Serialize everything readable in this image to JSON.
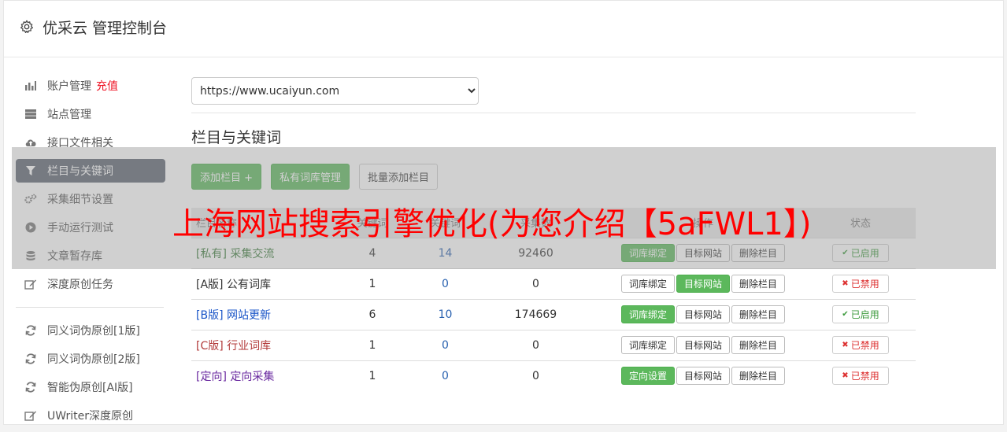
{
  "header": {
    "title": "优采云 管理控制台"
  },
  "sidebar": {
    "items": [
      {
        "label": "账户管理",
        "extra": "充值",
        "icon": "bar-chart-icon"
      },
      {
        "label": "站点管理",
        "icon": "server-icon"
      },
      {
        "label": "接口文件相关",
        "icon": "cloud-upload-icon"
      },
      {
        "label": "栏目与关键词",
        "icon": "filter-icon",
        "active": true
      },
      {
        "label": "采集细节设置",
        "icon": "cogs-icon"
      },
      {
        "label": "手动运行测试",
        "icon": "play-icon"
      },
      {
        "label": "文章暂存库",
        "icon": "database-icon"
      },
      {
        "label": "深度原创任务",
        "icon": "edit-icon"
      }
    ],
    "items2": [
      {
        "label": "同义词伪原创[1版]",
        "icon": "refresh-icon"
      },
      {
        "label": "同义词伪原创[2版]",
        "icon": "refresh-icon"
      },
      {
        "label": "智能伪原创[AI版]",
        "icon": "refresh-icon"
      },
      {
        "label": "UWriter深度原创",
        "icon": "edit-icon"
      }
    ]
  },
  "main": {
    "site_select": "https://www.ucaiyun.com",
    "section_title": "栏目与关键词",
    "buttons": {
      "add": "添加栏目 +",
      "private_lib": "私有词库管理",
      "batch_add": "批量添加栏目"
    },
    "table": {
      "headers": [
        "栏目名称",
        "关键词",
        "关键词",
        "采集数",
        "操作",
        "状态"
      ],
      "rows": [
        {
          "tag": "[私有]",
          "name": "采集交流",
          "c1": "4",
          "c2": "14",
          "c3": "92460",
          "ops": [
            "词库绑定",
            "目标网站",
            "删除栏目"
          ],
          "green": 0,
          "status": "已启用",
          "on": true,
          "cls": "tag-private"
        },
        {
          "tag": "[A版]",
          "name": "公有词库",
          "c1": "1",
          "c2": "0",
          "c3": "0",
          "ops": [
            "词库绑定",
            "目标网站",
            "删除栏目"
          ],
          "green": 1,
          "status": "已禁用",
          "on": false,
          "cls": "tag-a"
        },
        {
          "tag": "[B版]",
          "name": "网站更新",
          "c1": "6",
          "c2": "10",
          "c3": "174669",
          "ops": [
            "词库绑定",
            "目标网站",
            "删除栏目"
          ],
          "green": 0,
          "status": "已启用",
          "on": true,
          "cls": "tag-b"
        },
        {
          "tag": "[C版]",
          "name": "行业词库",
          "c1": "1",
          "c2": "0",
          "c3": "0",
          "ops": [
            "词库绑定",
            "目标网站",
            "删除栏目"
          ],
          "green": -1,
          "status": "已禁用",
          "on": false,
          "cls": "tag-c"
        },
        {
          "tag": "[定向]",
          "name": "定向采集",
          "c1": "1",
          "c2": "0",
          "c3": "0",
          "ops": [
            "定向设置",
            "目标网站",
            "删除栏目"
          ],
          "green": 0,
          "status": "已禁用",
          "on": false,
          "cls": "tag-d"
        }
      ]
    }
  },
  "overlay": {
    "text": "上海网站搜索引擎优化(为您介绍【5aFWL1】)"
  }
}
